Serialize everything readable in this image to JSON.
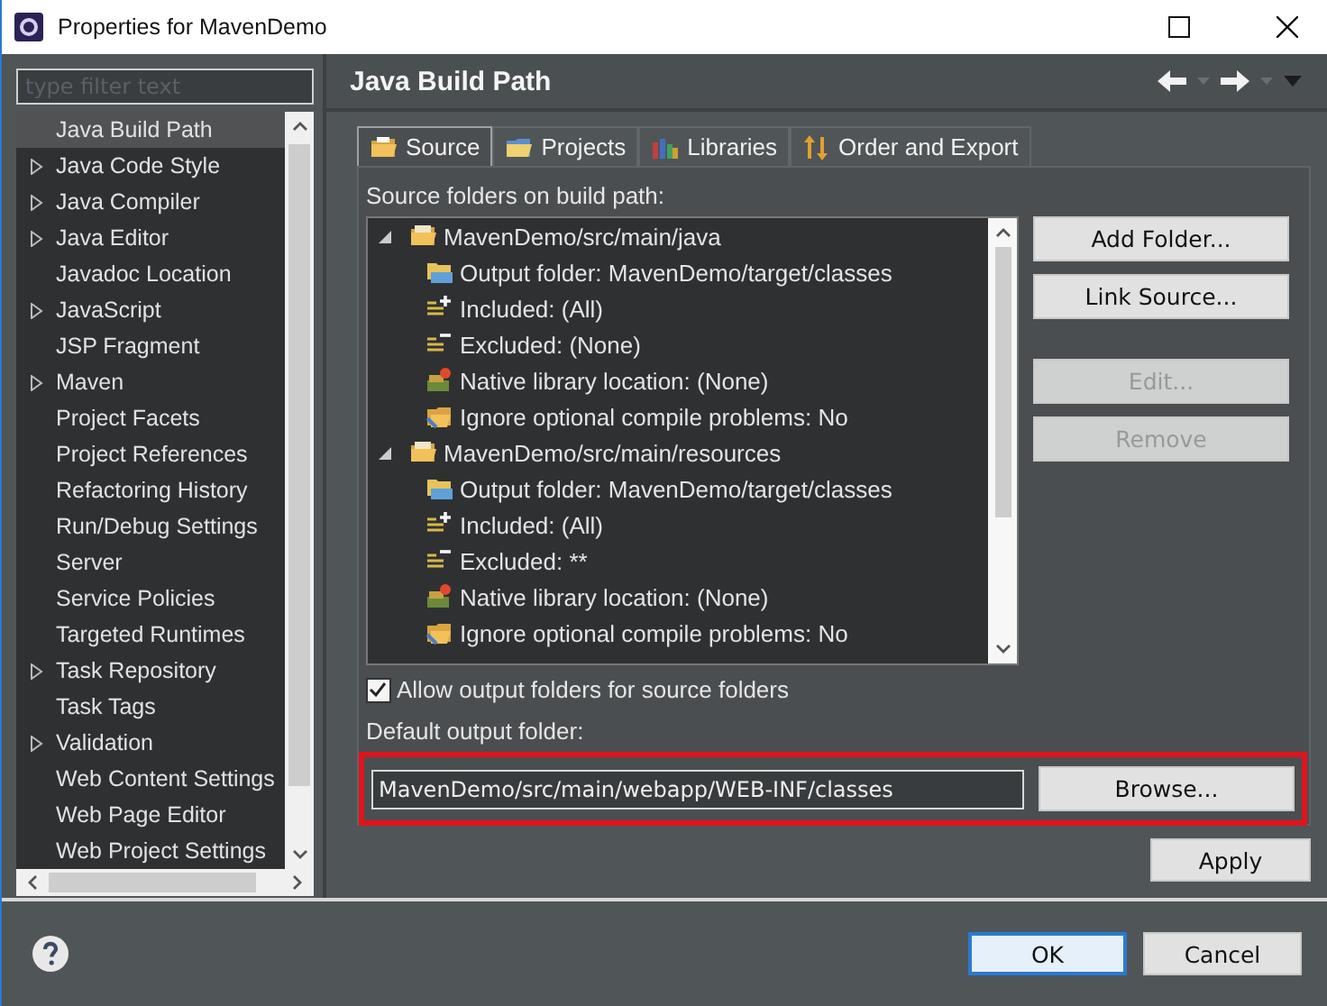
{
  "window": {
    "title": "Properties for MavenDemo"
  },
  "filter": {
    "placeholder": "type filter text"
  },
  "sidebar": {
    "items": [
      {
        "label": "Java Build Path",
        "expandable": false,
        "selected": true
      },
      {
        "label": "Java Code Style",
        "expandable": true,
        "selected": false
      },
      {
        "label": "Java Compiler",
        "expandable": true,
        "selected": false
      },
      {
        "label": "Java Editor",
        "expandable": true,
        "selected": false
      },
      {
        "label": "Javadoc Location",
        "expandable": false,
        "selected": false
      },
      {
        "label": "JavaScript",
        "expandable": true,
        "selected": false
      },
      {
        "label": "JSP Fragment",
        "expandable": false,
        "selected": false
      },
      {
        "label": "Maven",
        "expandable": true,
        "selected": false
      },
      {
        "label": "Project Facets",
        "expandable": false,
        "selected": false
      },
      {
        "label": "Project References",
        "expandable": false,
        "selected": false
      },
      {
        "label": "Refactoring History",
        "expandable": false,
        "selected": false
      },
      {
        "label": "Run/Debug Settings",
        "expandable": false,
        "selected": false
      },
      {
        "label": "Server",
        "expandable": false,
        "selected": false
      },
      {
        "label": "Service Policies",
        "expandable": false,
        "selected": false
      },
      {
        "label": "Targeted Runtimes",
        "expandable": false,
        "selected": false
      },
      {
        "label": "Task Repository",
        "expandable": true,
        "selected": false
      },
      {
        "label": "Task Tags",
        "expandable": false,
        "selected": false
      },
      {
        "label": "Validation",
        "expandable": true,
        "selected": false
      },
      {
        "label": "Web Content Settings",
        "expandable": false,
        "selected": false
      },
      {
        "label": "Web Page Editor",
        "expandable": false,
        "selected": false
      },
      {
        "label": "Web Project Settings",
        "expandable": false,
        "selected": false
      }
    ]
  },
  "page": {
    "title": "Java Build Path"
  },
  "tabs": [
    {
      "label": "Source",
      "kind": "source",
      "selected": true
    },
    {
      "label": "Projects",
      "kind": "projects",
      "selected": false
    },
    {
      "label": "Libraries",
      "kind": "libraries",
      "selected": false
    },
    {
      "label": "Order and Export",
      "kind": "order",
      "selected": false
    }
  ],
  "source_label": "Source folders on build path:",
  "tree": [
    {
      "label": "MavenDemo/src/main/java",
      "kind": "folder",
      "expanded": true,
      "children": [
        {
          "label": "Output folder: MavenDemo/target/classes",
          "kind": "output"
        },
        {
          "label": "Included: (All)",
          "kind": "included"
        },
        {
          "label": "Excluded: (None)",
          "kind": "excluded"
        },
        {
          "label": "Native library location: (None)",
          "kind": "native"
        },
        {
          "label": "Ignore optional compile problems: No",
          "kind": "ignore"
        }
      ]
    },
    {
      "label": "MavenDemo/src/main/resources",
      "kind": "folder",
      "expanded": true,
      "children": [
        {
          "label": "Output folder: MavenDemo/target/classes",
          "kind": "output"
        },
        {
          "label": "Included: (All)",
          "kind": "included"
        },
        {
          "label": "Excluded: **",
          "kind": "excluded"
        },
        {
          "label": "Native library location: (None)",
          "kind": "native"
        },
        {
          "label": "Ignore optional compile problems: No",
          "kind": "ignore"
        }
      ]
    }
  ],
  "side_buttons": [
    {
      "label": "Add Folder...",
      "disabled": false
    },
    {
      "label": "Link Source...",
      "disabled": false
    },
    {
      "label": "Edit...",
      "disabled": true
    },
    {
      "label": "Remove",
      "disabled": true
    }
  ],
  "allow_output": {
    "label": "Allow output folders for source folders",
    "checked": true
  },
  "default_output": {
    "label": "Default output folder:",
    "value": "MavenDemo/src/main/webapp/WEB-INF/classes",
    "highlighted": true
  },
  "browse_button": "Browse...",
  "apply_button": "Apply",
  "footer_buttons": [
    {
      "label": "OK",
      "default": true
    },
    {
      "label": "Cancel",
      "default": false
    }
  ]
}
